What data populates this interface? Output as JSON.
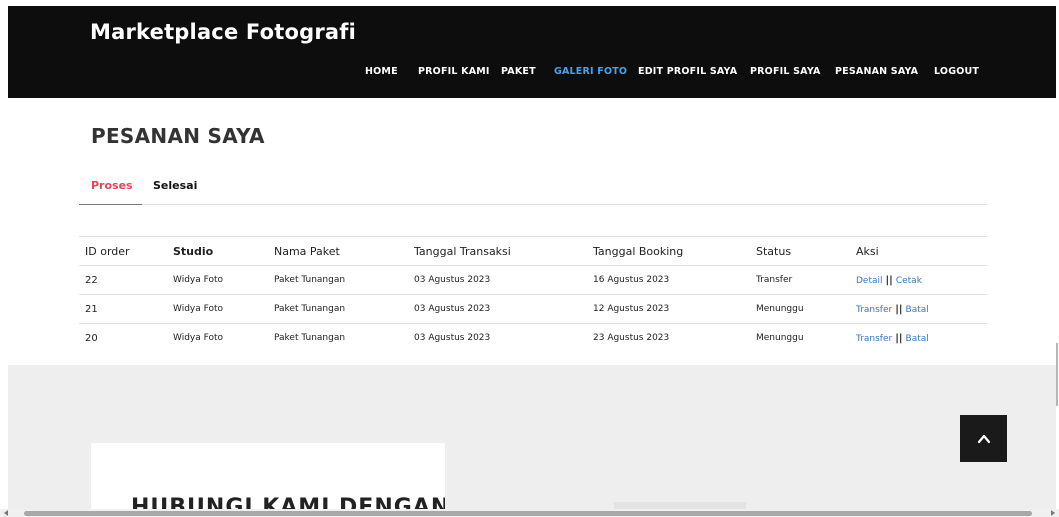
{
  "header": {
    "brand": "Marketplace Fotografi",
    "nav": [
      {
        "label": "HOME",
        "active": false
      },
      {
        "label": "PROFIL KAMI",
        "active": false
      },
      {
        "label": "PAKET",
        "active": false
      },
      {
        "label": "GALERI FOTO",
        "active": true
      },
      {
        "label": "EDIT PROFIL SAYA",
        "active": false
      },
      {
        "label": "PROFIL SAYA",
        "active": false
      },
      {
        "label": "PESANAN SAYA",
        "active": false
      },
      {
        "label": "LOGOUT",
        "active": false
      }
    ]
  },
  "main": {
    "title": "PESANAN SAYA",
    "tabs": [
      {
        "label": "Proses",
        "active": true
      },
      {
        "label": "Selesai",
        "active": false
      }
    ],
    "table": {
      "headers": [
        "ID order",
        "Studio",
        "Nama Paket",
        "Tanggal Transaksi",
        "Tanggal Booking",
        "Status",
        "Aksi"
      ],
      "rows": [
        {
          "id": "22",
          "studio": "Widya Foto",
          "paket": "Paket Tunangan",
          "transaksi": "03 Agustus 2023",
          "booking": "16 Agustus 2023",
          "status": "Transfer",
          "actions": [
            "Detail",
            "Cetak"
          ]
        },
        {
          "id": "21",
          "studio": "Widya Foto",
          "paket": "Paket Tunangan",
          "transaksi": "03 Agustus 2023",
          "booking": "12 Agustus 2023",
          "status": "Menunggu",
          "actions": [
            "Transfer",
            "Batal"
          ]
        },
        {
          "id": "20",
          "studio": "Widya Foto",
          "paket": "Paket Tunangan",
          "transaksi": "03 Agustus 2023",
          "booking": "23 Agustus 2023",
          "status": "Menunggu",
          "actions": [
            "Transfer",
            "Batal"
          ]
        }
      ],
      "separator": "||"
    }
  },
  "footer": {
    "contact_heading": "HUBUNGI KAMI DENGAN"
  },
  "icons": {
    "scroll_top": "chevron-up-icon"
  },
  "colors": {
    "header_bg": "#0d0d0d",
    "nav_active": "#4aa3e8",
    "tab_active": "#e8435a",
    "link": "#3a76c4"
  }
}
